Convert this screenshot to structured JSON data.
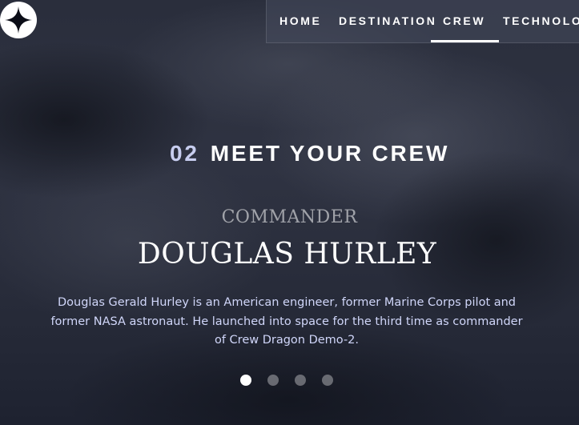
{
  "nav": {
    "items": [
      {
        "label": "HOME"
      },
      {
        "label": "DESTINATION"
      },
      {
        "label": "CREW",
        "active": true
      },
      {
        "label": "TECHNOLOGY"
      }
    ]
  },
  "heading": {
    "number": "02",
    "title": "MEET YOUR CREW"
  },
  "crew": {
    "role": "COMMANDER",
    "name": "DOUGLAS HURLEY",
    "bio": "Douglas Gerald Hurley is an American engineer, former Marine Corps pilot and former NASA astronaut. He launched into space for the third time as commander of Crew Dragon Demo-2."
  },
  "pagination": {
    "count": 4,
    "active_index": 0
  },
  "colors": {
    "accent": "#d0d6f9",
    "background": "#1f2230"
  },
  "icons": {
    "logo": "star-logo-icon"
  }
}
